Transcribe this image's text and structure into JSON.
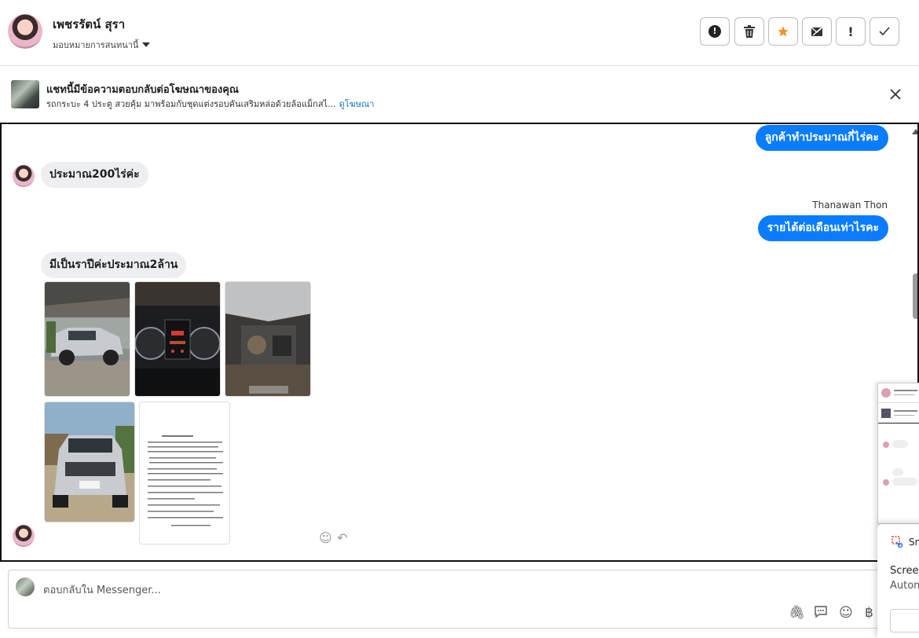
{
  "header": {
    "contact_name": "เพชรรัตน์ สุรา",
    "assign_label": "มอบหมายการสนทนานี้",
    "toolbar": [
      {
        "name": "spam-button",
        "icon": "alert-circle-icon",
        "glyph": "●"
      },
      {
        "name": "delete-button",
        "icon": "trash-icon",
        "glyph": "🗑"
      },
      {
        "name": "star-button",
        "icon": "star-icon",
        "glyph": "★"
      },
      {
        "name": "mark-unread-button",
        "icon": "envelope-icon",
        "glyph": "✉"
      },
      {
        "name": "follow-up-button",
        "icon": "exclamation-icon",
        "glyph": "!"
      },
      {
        "name": "mark-done-button",
        "icon": "check-icon",
        "glyph": "✓"
      }
    ]
  },
  "ad_banner": {
    "title": "แชทนี้มีข้อความตอบกลับต่อโฆษณาของคุณ",
    "description": "รถกระบะ 4 ประตู สวยคุ้ม มาพร้อมกับชุดแต่งรอบคันเสริมหล่อด้วยล้อแม็กสไ...",
    "link": "ดูโฆษณา"
  },
  "messages": {
    "out_1": "ลูกค้าทำประมาณกี่ไร่คะ",
    "in_1": "ประมาณ200ไร่ค่ะ",
    "sender": "Thanawan Thon",
    "out_2": "รายได้ต่อเดือนเท่าไรคะ",
    "in_2": "มีเป็นราปีค่ะประมาณ2ล้าน"
  },
  "composer": {
    "placeholder": "ตอบกลับใน Messenger..."
  },
  "notification": {
    "app": "Sn",
    "line1": "Screer",
    "line2": "Autom"
  },
  "colors": {
    "accent": "#0a7cff",
    "incoming_bubble": "#eceef1",
    "star": "#f0932b"
  }
}
